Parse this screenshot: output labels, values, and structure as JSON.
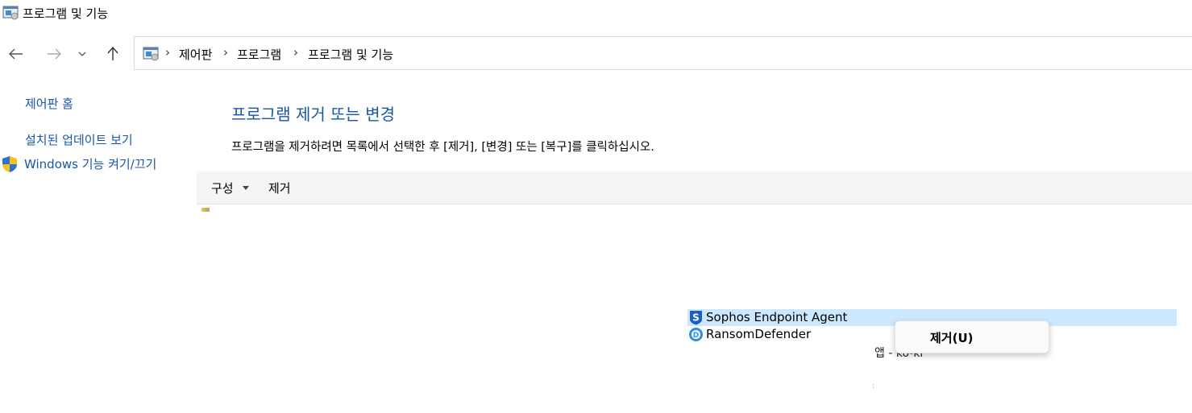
{
  "window": {
    "title": "프로그램 및 기능"
  },
  "nav": {
    "back_icon": "arrow-left-icon",
    "forward_icon": "arrow-right-icon",
    "recent_icon": "chevron-down-icon",
    "up_icon": "arrow-up-icon"
  },
  "address": {
    "separator": "›",
    "crumbs": [
      "제어판",
      "프로그램",
      "프로그램 및 기능"
    ]
  },
  "sidebar": {
    "items": [
      {
        "label": "제어판 홈"
      },
      {
        "label": "설치된 업데이트 보기"
      },
      {
        "label": "Windows 기능 켜기/끄기",
        "icon": "shield-icon"
      }
    ]
  },
  "main": {
    "heading": "프로그램 제거 또는 변경",
    "instruction": "프로그램을 제거하려면 목록에서 선택한 후 [제거], [변경] 또는 [복구]를 클릭하십시오."
  },
  "toolbar": {
    "organize_label": "구성",
    "uninstall_label": "제거"
  },
  "programs": [
    {
      "name": "Sophos Endpoint Agent",
      "selected": true,
      "icon": "sophos-icon"
    },
    {
      "name": "RansomDefender",
      "selected": false,
      "icon": "ransomdefender-icon"
    }
  ],
  "partially_hidden_text": "앱 - ko-kr",
  "context_menu": {
    "items": [
      {
        "label": "제거(U)"
      }
    ]
  },
  "colors": {
    "link": "#1a56a8",
    "selection": "#cce8ff",
    "toolbar_bg": "#f4f5f7"
  }
}
